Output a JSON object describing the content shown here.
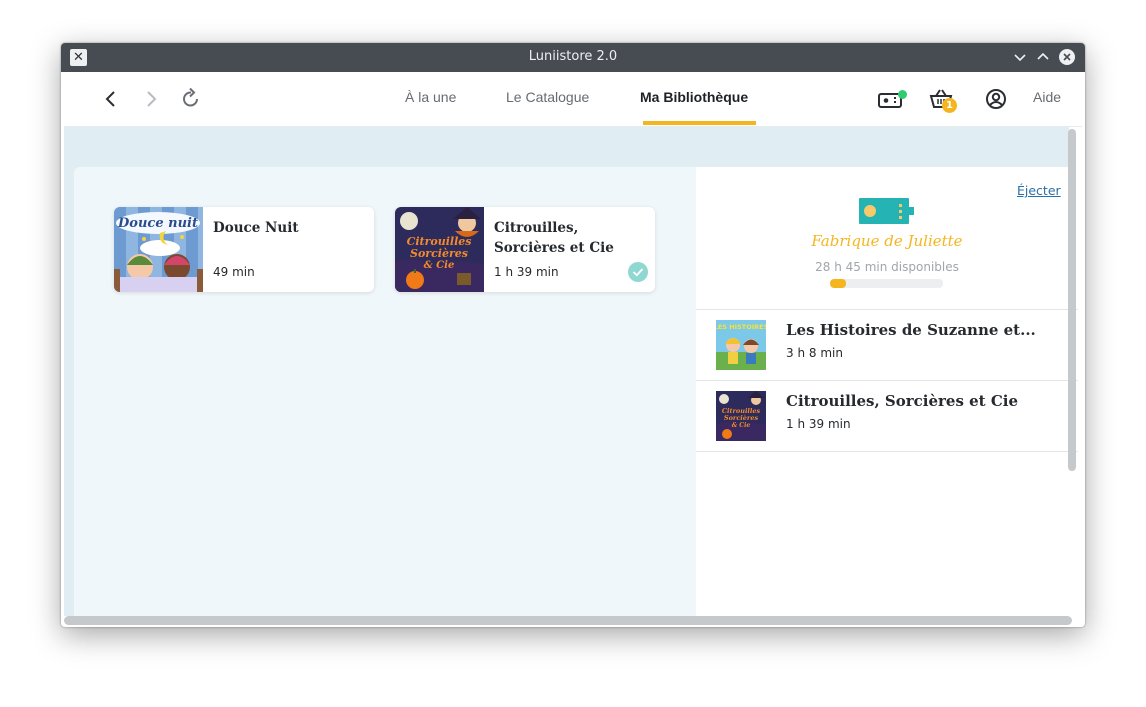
{
  "window": {
    "title": "Luniistore 2.0"
  },
  "header": {
    "tabs": [
      {
        "label": "À la une"
      },
      {
        "label": "Le Catalogue"
      },
      {
        "label": "Ma Bibliothèque",
        "active": true
      }
    ],
    "cart_count": "1",
    "help_label": "Aide"
  },
  "library": {
    "items": [
      {
        "title": "Douce Nuit",
        "cover_text": "Douce nuit",
        "duration": "49 min",
        "synced": false
      },
      {
        "title": "Citrouilles, Sorcières et Cie",
        "cover_text_lines": [
          "Citrouilles",
          "Sorcières",
          "& Cie"
        ],
        "duration": "1 h 39 min",
        "synced": true
      }
    ]
  },
  "device": {
    "eject_label": "Éjecter",
    "name": "Fabrique de Juliette",
    "available": "28 h 45 min disponibles",
    "usage_fraction": 0.14,
    "stories": [
      {
        "title": "Les Histoires de Suzanne et...",
        "cover_text": "LES HISTOIRES",
        "duration": "3 h 8 min"
      },
      {
        "title": "Citrouilles, Sorcières et Cie",
        "cover_text_lines": [
          "Citrouilles",
          "Sorcières",
          "& Cie"
        ],
        "duration": "1 h 39 min"
      }
    ]
  },
  "colors": {
    "accent": "#f5b51e",
    "teal": "#26b3b4",
    "sync_check": "#8fd8d2",
    "link": "#2a6fa8",
    "online_dot": "#2ecc71"
  }
}
